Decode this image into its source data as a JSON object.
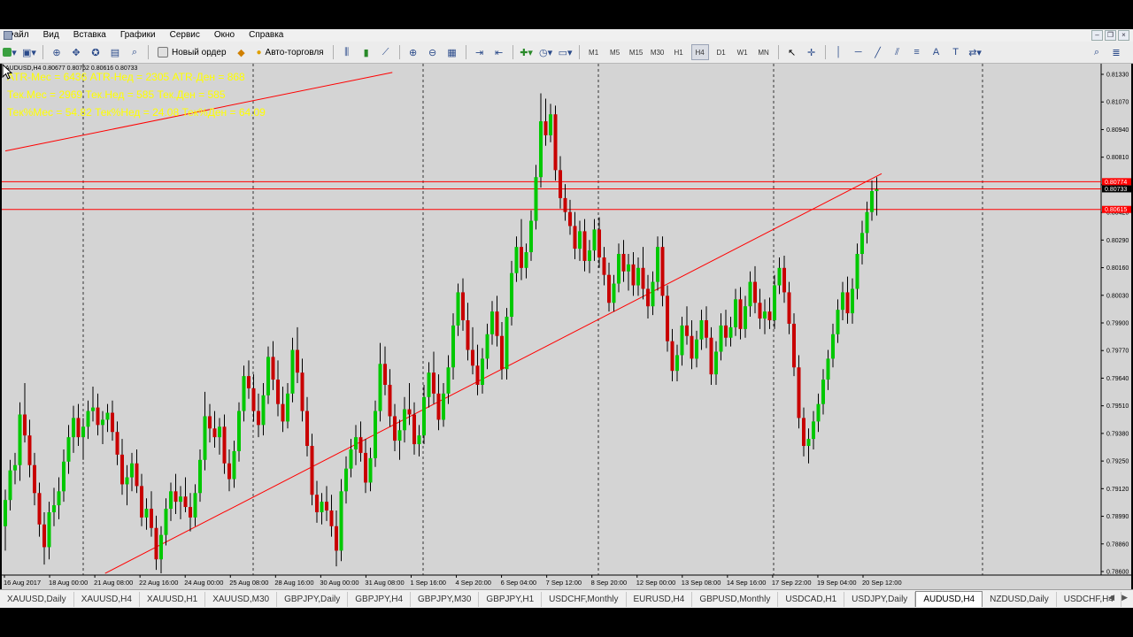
{
  "menu": [
    "Файл",
    "Вид",
    "Вставка",
    "Графики",
    "Сервис",
    "Окно",
    "Справка"
  ],
  "toolbar": {
    "new_order": "Новый ордер",
    "auto_trading": "Авто-торговля",
    "timeframes": [
      "M1",
      "M5",
      "M15",
      "M30",
      "H1",
      "H4",
      "D1",
      "W1",
      "MN"
    ],
    "active_timeframe": "H4"
  },
  "chart": {
    "header": "AUDUSD,H4  0.80677 0.80762 0.80616 0.80733",
    "atr_lines": [
      "ATR-Мес = 6436  ATR-Нед = 2305  ATR-Ден = 868",
      "Тек.Мес = 2969   Тек.Нед = 585   Тек.Ден = 585",
      "Тек%Мес = 54.82   Тек%Нед = 24.08   Тек%Ден = 64.09"
    ],
    "atr_color": "#ffff00",
    "price_labels": [
      "0.81330",
      "0.81070",
      "0.80940",
      "0.80810",
      "0.80680",
      "0.80420",
      "0.80290",
      "0.80160",
      "0.80030",
      "0.79900",
      "0.79770",
      "0.79640",
      "0.79510",
      "0.79380",
      "0.79250",
      "0.79120",
      "0.78990",
      "0.78860",
      "0.78600"
    ],
    "marked_prices": [
      {
        "text": "0.80774",
        "bg": "#ff0000"
      },
      {
        "text": "0.80733",
        "bg": "#000000"
      },
      {
        "text": "0.80615",
        "bg": "#ff0000"
      }
    ],
    "time_labels": [
      "16 Aug 2017",
      "18 Aug 00:00",
      "21 Aug 08:00",
      "22 Aug 16:00",
      "24 Aug 00:00",
      "25 Aug 08:00",
      "28 Aug 16:00",
      "30 Aug 00:00",
      "31 Aug 08:00",
      "1 Sep 16:00",
      "4 Sep 20:00",
      "6 Sep 04:00",
      "7 Sep 12:00",
      "8 Sep 20:00",
      "12 Sep 00:00",
      "13 Sep 08:00",
      "14 Sep 16:00",
      "17 Sep 22:00",
      "19 Sep 04:00",
      "20 Sep 12:00"
    ],
    "bull_color": "#00c800",
    "bear_color": "#c80000",
    "line_color": "#ff0000"
  },
  "chart_data": {
    "type": "candlestick",
    "symbol": "AUDUSD",
    "timeframe": "H4",
    "ylim": [
      0.7852,
      0.8145
    ],
    "grid": false,
    "horizontal_levels": [
      0.80774,
      0.80733,
      0.80615
    ],
    "trendlines": [
      {
        "from": [
          0,
          0.8095
        ],
        "to": [
          79.5,
          0.814
        ]
      },
      {
        "from": [
          20.5,
          0.7853
        ],
        "to": [
          180,
          0.8082
        ]
      }
    ],
    "candles": [
      [
        0.788,
        0.7901,
        0.7866,
        0.7895
      ],
      [
        0.7895,
        0.7918,
        0.7889,
        0.7912
      ],
      [
        0.7912,
        0.7922,
        0.7904,
        0.7915
      ],
      [
        0.7915,
        0.7951,
        0.7906,
        0.7944
      ],
      [
        0.7944,
        0.7962,
        0.7928,
        0.7932
      ],
      [
        0.7932,
        0.7941,
        0.7908,
        0.7915
      ],
      [
        0.7915,
        0.7922,
        0.7892,
        0.7899
      ],
      [
        0.7899,
        0.7905,
        0.7874,
        0.7881
      ],
      [
        0.7881,
        0.7888,
        0.7858,
        0.7868
      ],
      [
        0.7868,
        0.7894,
        0.7861,
        0.7888
      ],
      [
        0.7888,
        0.7902,
        0.788,
        0.7892
      ],
      [
        0.7892,
        0.7908,
        0.7884,
        0.79
      ],
      [
        0.79,
        0.7924,
        0.7894,
        0.7917
      ],
      [
        0.7917,
        0.7938,
        0.791,
        0.7931
      ],
      [
        0.7931,
        0.7949,
        0.7922,
        0.7942
      ],
      [
        0.7942,
        0.795,
        0.7926,
        0.7931
      ],
      [
        0.7931,
        0.7942,
        0.7918,
        0.7937
      ],
      [
        0.7937,
        0.7952,
        0.793,
        0.7946
      ],
      [
        0.7946,
        0.796,
        0.794,
        0.7948
      ],
      [
        0.7948,
        0.7956,
        0.7932,
        0.7938
      ],
      [
        0.7938,
        0.7946,
        0.7927,
        0.7941
      ],
      [
        0.7941,
        0.795,
        0.7934,
        0.7945
      ],
      [
        0.7945,
        0.7952,
        0.7929,
        0.7934
      ],
      [
        0.7934,
        0.794,
        0.7915,
        0.7921
      ],
      [
        0.7921,
        0.793,
        0.7898,
        0.7904
      ],
      [
        0.7904,
        0.7915,
        0.7892,
        0.7908
      ],
      [
        0.7908,
        0.7922,
        0.79,
        0.7916
      ],
      [
        0.7916,
        0.7924,
        0.7899,
        0.7903
      ],
      [
        0.7903,
        0.791,
        0.788,
        0.7885
      ],
      [
        0.7885,
        0.7896,
        0.7878,
        0.789
      ],
      [
        0.789,
        0.79,
        0.7874,
        0.7879
      ],
      [
        0.7879,
        0.7886,
        0.7855,
        0.7861
      ],
      [
        0.7861,
        0.788,
        0.7853,
        0.7875
      ],
      [
        0.7875,
        0.7896,
        0.7869,
        0.789
      ],
      [
        0.789,
        0.7905,
        0.7883,
        0.79
      ],
      [
        0.79,
        0.791,
        0.7887,
        0.7894
      ],
      [
        0.7894,
        0.7903,
        0.7884,
        0.7897
      ],
      [
        0.7897,
        0.7908,
        0.7888,
        0.7891
      ],
      [
        0.7891,
        0.7899,
        0.7877,
        0.7885
      ],
      [
        0.7885,
        0.7904,
        0.788,
        0.7899
      ],
      [
        0.7899,
        0.7924,
        0.7894,
        0.7918
      ],
      [
        0.7918,
        0.7957,
        0.7912,
        0.7943
      ],
      [
        0.7943,
        0.795,
        0.7928,
        0.7936
      ],
      [
        0.7936,
        0.7946,
        0.7925,
        0.7931
      ],
      [
        0.7931,
        0.7942,
        0.7921,
        0.7937
      ],
      [
        0.7937,
        0.7944,
        0.791,
        0.7916
      ],
      [
        0.7916,
        0.7924,
        0.79,
        0.7907
      ],
      [
        0.7907,
        0.7929,
        0.7902,
        0.7923
      ],
      [
        0.7923,
        0.7951,
        0.7917,
        0.7946
      ],
      [
        0.7946,
        0.7972,
        0.794,
        0.7966
      ],
      [
        0.7966,
        0.7975,
        0.7953,
        0.7959
      ],
      [
        0.7959,
        0.7967,
        0.794,
        0.7946
      ],
      [
        0.7946,
        0.7956,
        0.7931,
        0.7938
      ],
      [
        0.7938,
        0.7962,
        0.7932,
        0.7955
      ],
      [
        0.7955,
        0.7983,
        0.795,
        0.7977
      ],
      [
        0.7977,
        0.7986,
        0.7958,
        0.7964
      ],
      [
        0.7964,
        0.7975,
        0.7943,
        0.795
      ],
      [
        0.795,
        0.796,
        0.7934,
        0.794
      ],
      [
        0.794,
        0.7962,
        0.7936,
        0.7956
      ],
      [
        0.7956,
        0.7988,
        0.7951,
        0.7981
      ],
      [
        0.7981,
        0.7994,
        0.7962,
        0.7968
      ],
      [
        0.7968,
        0.7976,
        0.794,
        0.7946
      ],
      [
        0.7946,
        0.7954,
        0.792,
        0.7926
      ],
      [
        0.7926,
        0.7933,
        0.7892,
        0.7898
      ],
      [
        0.7898,
        0.7906,
        0.7882,
        0.7888
      ],
      [
        0.7888,
        0.7899,
        0.7881,
        0.7894
      ],
      [
        0.7894,
        0.7903,
        0.7883,
        0.7889
      ],
      [
        0.7889,
        0.7898,
        0.7874,
        0.788
      ],
      [
        0.788,
        0.7889,
        0.7857,
        0.7866
      ],
      [
        0.7866,
        0.7907,
        0.786,
        0.79
      ],
      [
        0.79,
        0.792,
        0.7893,
        0.7913
      ],
      [
        0.7913,
        0.793,
        0.7908,
        0.7924
      ],
      [
        0.7924,
        0.7938,
        0.7915,
        0.7931
      ],
      [
        0.7931,
        0.794,
        0.7917,
        0.7922
      ],
      [
        0.7922,
        0.793,
        0.7899,
        0.7905
      ],
      [
        0.7905,
        0.7925,
        0.79,
        0.7919
      ],
      [
        0.7919,
        0.7952,
        0.7914,
        0.7946
      ],
      [
        0.7946,
        0.7985,
        0.794,
        0.7973
      ],
      [
        0.7973,
        0.7983,
        0.7955,
        0.7961
      ],
      [
        0.7961,
        0.797,
        0.7937,
        0.7943
      ],
      [
        0.7943,
        0.795,
        0.7923,
        0.7929
      ],
      [
        0.7929,
        0.7941,
        0.7918,
        0.7935
      ],
      [
        0.7935,
        0.7954,
        0.7928,
        0.7947
      ],
      [
        0.7947,
        0.7962,
        0.7938,
        0.7944
      ],
      [
        0.7944,
        0.7951,
        0.7921,
        0.7927
      ],
      [
        0.7927,
        0.7938,
        0.792,
        0.7932
      ],
      [
        0.7932,
        0.7961,
        0.7927,
        0.7954
      ],
      [
        0.7954,
        0.7974,
        0.7948,
        0.7968
      ],
      [
        0.7968,
        0.798,
        0.795,
        0.7956
      ],
      [
        0.7956,
        0.7967,
        0.7935,
        0.7941
      ],
      [
        0.7941,
        0.7962,
        0.7937,
        0.7956
      ],
      [
        0.7956,
        0.7978,
        0.795,
        0.7971
      ],
      [
        0.7971,
        0.8002,
        0.7964,
        0.7995
      ],
      [
        0.7995,
        0.8019,
        0.7989,
        0.8014
      ],
      [
        0.8014,
        0.8022,
        0.7992,
        0.7998
      ],
      [
        0.7998,
        0.8008,
        0.7975,
        0.7981
      ],
      [
        0.7981,
        0.7994,
        0.7967,
        0.7972
      ],
      [
        0.7972,
        0.7984,
        0.7955,
        0.7961
      ],
      [
        0.7961,
        0.7982,
        0.7956,
        0.7976
      ],
      [
        0.7976,
        0.7996,
        0.797,
        0.799
      ],
      [
        0.799,
        0.8009,
        0.7984,
        0.8003
      ],
      [
        0.8003,
        0.8012,
        0.7983,
        0.7989
      ],
      [
        0.7989,
        0.7997,
        0.7964,
        0.797
      ],
      [
        0.797,
        0.8005,
        0.7964,
        0.8
      ],
      [
        0.8,
        0.8032,
        0.7995,
        0.8025
      ],
      [
        0.8025,
        0.8046,
        0.802,
        0.804
      ],
      [
        0.804,
        0.8056,
        0.8021,
        0.8028
      ],
      [
        0.8028,
        0.8042,
        0.8022,
        0.8037
      ],
      [
        0.8037,
        0.8061,
        0.8032,
        0.8055
      ],
      [
        0.8055,
        0.8087,
        0.805,
        0.808
      ],
      [
        0.808,
        0.8128,
        0.8074,
        0.8112
      ],
      [
        0.8112,
        0.8125,
        0.8098,
        0.8104
      ],
      [
        0.8104,
        0.8122,
        0.81,
        0.8116
      ],
      [
        0.8116,
        0.8121,
        0.8078,
        0.8084
      ],
      [
        0.8084,
        0.8092,
        0.8062,
        0.8068
      ],
      [
        0.8068,
        0.8076,
        0.8055,
        0.806
      ],
      [
        0.806,
        0.8067,
        0.8047,
        0.8052
      ],
      [
        0.8052,
        0.806,
        0.8033,
        0.8039
      ],
      [
        0.8039,
        0.8055,
        0.8032,
        0.8049
      ],
      [
        0.8049,
        0.8056,
        0.8026,
        0.8032
      ],
      [
        0.8032,
        0.8044,
        0.8025,
        0.8038
      ],
      [
        0.8038,
        0.8056,
        0.8032,
        0.805
      ],
      [
        0.805,
        0.8057,
        0.8028,
        0.8034
      ],
      [
        0.8034,
        0.804,
        0.8018,
        0.8024
      ],
      [
        0.8024,
        0.8031,
        0.8003,
        0.8008
      ],
      [
        0.8008,
        0.8024,
        0.8003,
        0.8019
      ],
      [
        0.8019,
        0.8042,
        0.8014,
        0.8036
      ],
      [
        0.8036,
        0.8044,
        0.802,
        0.8026
      ],
      [
        0.8026,
        0.8036,
        0.8015,
        0.803
      ],
      [
        0.803,
        0.8037,
        0.8012,
        0.8018
      ],
      [
        0.8018,
        0.8034,
        0.8012,
        0.8028
      ],
      [
        0.8028,
        0.804,
        0.801,
        0.8016
      ],
      [
        0.8016,
        0.8024,
        0.7999,
        0.8006
      ],
      [
        0.8006,
        0.8026,
        0.8001,
        0.802
      ],
      [
        0.802,
        0.8046,
        0.8015,
        0.804
      ],
      [
        0.804,
        0.8046,
        0.8006,
        0.8012
      ],
      [
        0.8012,
        0.8018,
        0.798,
        0.7986
      ],
      [
        0.7986,
        0.7993,
        0.7963,
        0.7969
      ],
      [
        0.7969,
        0.7984,
        0.7963,
        0.7978
      ],
      [
        0.7978,
        0.8,
        0.7972,
        0.7995
      ],
      [
        0.7995,
        0.8006,
        0.7984,
        0.7989
      ],
      [
        0.7989,
        0.7998,
        0.797,
        0.7976
      ],
      [
        0.7976,
        0.7992,
        0.7971,
        0.7987
      ],
      [
        0.7987,
        0.8004,
        0.7981,
        0.7998
      ],
      [
        0.7998,
        0.8006,
        0.7982,
        0.7988
      ],
      [
        0.7988,
        0.7994,
        0.7961,
        0.7967
      ],
      [
        0.7967,
        0.7986,
        0.7961,
        0.798
      ],
      [
        0.798,
        0.8002,
        0.7975,
        0.7995
      ],
      [
        0.7995,
        0.8004,
        0.7983,
        0.7988
      ],
      [
        0.7988,
        0.8,
        0.7983,
        0.7994
      ],
      [
        0.7994,
        0.8016,
        0.7989,
        0.801
      ],
      [
        0.801,
        0.8017,
        0.7987,
        0.7993
      ],
      [
        0.7993,
        0.8012,
        0.7988,
        0.8006
      ],
      [
        0.8006,
        0.8026,
        0.8,
        0.802
      ],
      [
        0.802,
        0.8029,
        0.8002,
        0.8008
      ],
      [
        0.8008,
        0.8016,
        0.7993,
        0.7999
      ],
      [
        0.7999,
        0.801,
        0.799,
        0.8003
      ],
      [
        0.8003,
        0.8011,
        0.7993,
        0.7998
      ],
      [
        0.7998,
        0.8024,
        0.7993,
        0.8018
      ],
      [
        0.8018,
        0.8034,
        0.8013,
        0.8028
      ],
      [
        0.8028,
        0.8035,
        0.8008,
        0.8014
      ],
      [
        0.8014,
        0.802,
        0.799,
        0.7996
      ],
      [
        0.7996,
        0.8002,
        0.7966,
        0.7971
      ],
      [
        0.7971,
        0.7978,
        0.7936,
        0.7942
      ],
      [
        0.7942,
        0.7948,
        0.792,
        0.7926
      ],
      [
        0.7926,
        0.7936,
        0.7916,
        0.793
      ],
      [
        0.793,
        0.7946,
        0.7924,
        0.794
      ],
      [
        0.794,
        0.7956,
        0.7934,
        0.795
      ],
      [
        0.795,
        0.797,
        0.7944,
        0.7964
      ],
      [
        0.7964,
        0.7981,
        0.7958,
        0.7976
      ],
      [
        0.7976,
        0.7996,
        0.7971,
        0.799
      ],
      [
        0.799,
        0.801,
        0.7985,
        0.8004
      ],
      [
        0.8004,
        0.802,
        0.7998,
        0.8014
      ],
      [
        0.8014,
        0.8023,
        0.7996,
        0.8002
      ],
      [
        0.8002,
        0.8022,
        0.7996,
        0.8016
      ],
      [
        0.8016,
        0.8042,
        0.801,
        0.8036
      ],
      [
        0.8036,
        0.8055,
        0.803,
        0.8048
      ],
      [
        0.8048,
        0.8066,
        0.8042,
        0.806
      ],
      [
        0.806,
        0.8078,
        0.8055,
        0.8072
      ],
      [
        0.8072,
        0.808,
        0.8058,
        0.8073
      ]
    ]
  },
  "tabs": [
    "XAUUSD,Daily",
    "XAUUSD,H4",
    "XAUUSD,H1",
    "XAUUSD,M30",
    "GBPJPY,Daily",
    "GBPJPY,H4",
    "GBPJPY,M30",
    "GBPJPY,H1",
    "USDCHF,Monthly",
    "EURUSD,H4",
    "GBPUSD,Monthly",
    "USDCAD,H1",
    "USDJPY,Daily",
    "AUDUSD,H4",
    "NZDUSD,Daily",
    "USDCHF,H4"
  ],
  "active_tab": "AUDUSD,H4"
}
